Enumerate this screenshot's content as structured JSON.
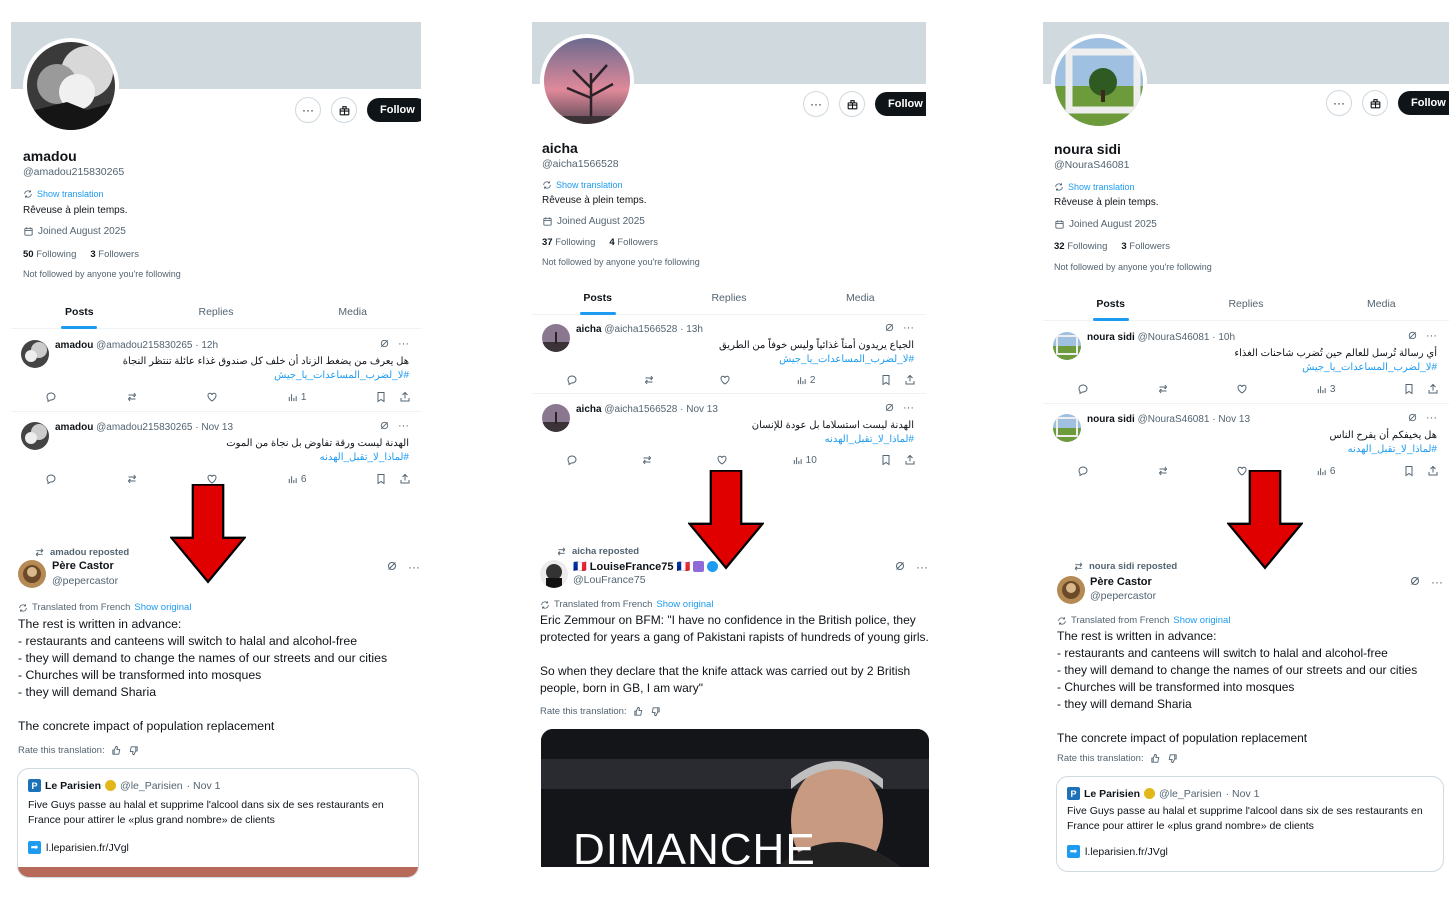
{
  "colors": {
    "accent": "#1d9bf0",
    "arrow": "#e10000",
    "banner": "#cfd9de"
  },
  "profiles": [
    {
      "name": "amadou",
      "handle": "@amadou215830265",
      "show_translation": "Show translation",
      "bio": "Rêveuse à plein temps.",
      "joined": "Joined August 2025",
      "following_count": "50",
      "following_label": "Following",
      "followers_count": "3",
      "followers_label": "Followers",
      "not_followed": "Not followed by anyone you're following",
      "follow": "Follow",
      "more": "···",
      "tabs": [
        "Posts",
        "Replies",
        "Media"
      ],
      "posts": [
        {
          "name": "amadou",
          "meta": "@amadou215830265 · 12h",
          "line1": "هل يعرف من يضغط الزناد أن خلف كل صندوق غذاء عائلة تنتظر النجاة",
          "tag": "#لا_لضرب_المساعدات_يا_جيش",
          "views": "1"
        },
        {
          "name": "amadou",
          "meta": "@amadou215830265 · Nov 13",
          "line1": "الهدنة ليست ورقة تفاوض بل نجاة من الموت",
          "tag": "#لماذا_لا_تقبل_الهدنه",
          "views": "6"
        }
      ]
    },
    {
      "name": "aicha",
      "handle": "@aicha1566528",
      "show_translation": "Show translation",
      "bio": "Rêveuse à plein temps.",
      "joined": "Joined August 2025",
      "following_count": "37",
      "following_label": "Following",
      "followers_count": "4",
      "followers_label": "Followers",
      "not_followed": "Not followed by anyone you're following",
      "follow": "Follow",
      "more": "···",
      "tabs": [
        "Posts",
        "Replies",
        "Media"
      ],
      "posts": [
        {
          "name": "aicha",
          "meta": "@aicha1566528 · 13h",
          "line1": "الجياع يريدون أمناً غذائياً وليس خوفاً من الطريق",
          "tag": "#لا_لضرب_المساعدات_يا_جيش",
          "views": "2"
        },
        {
          "name": "aicha",
          "meta": "@aicha1566528 · Nov 13",
          "line1": "الهدنة ليست استسلاما بل عودة للإنسان",
          "tag": "#لماذا_لا_تقبل_الهدنه",
          "views": "10"
        }
      ]
    },
    {
      "name": "noura sidi",
      "handle": "@NouraS46081",
      "show_translation": "Show translation",
      "bio": "Rêveuse à plein temps.",
      "joined": "Joined August 2025",
      "following_count": "32",
      "following_label": "Following",
      "followers_count": "3",
      "followers_label": "Followers",
      "not_followed": "Not followed by anyone you're following",
      "follow": "Follow",
      "more": "···",
      "tabs": [
        "Posts",
        "Replies",
        "Media"
      ],
      "posts": [
        {
          "name": "noura sidi",
          "meta": "@NouraS46081 · 10h",
          "line1": "أي رسالة تُرسل للعالم حين تُضرب شاحنات الغذاء",
          "tag": "#لا_لضرب_المساعدات_يا_جيش",
          "views": "3"
        },
        {
          "name": "noura sidi",
          "meta": "@NouraS46081 · Nov 13",
          "line1": "هل يخيفكم أن يفرح الناس",
          "tag": "#لماذا_لا_تقبل_الهدنه",
          "views": "6"
        }
      ]
    }
  ],
  "reposts": [
    {
      "reposted_by": "amadou reposted",
      "name": "Père Castor",
      "handle": "@pepercastor",
      "translated": "Translated from French",
      "show_original": "Show original",
      "body": [
        "The rest is written in advance:",
        "- restaurants and canteens will switch to halal and alcohol-free",
        "- they will demand to change the names of our streets and our cities",
        "- Churches will be transformed into mosques",
        "- they will demand Sharia",
        "",
        "The concrete impact of population replacement"
      ],
      "rate": "Rate this translation:",
      "quote": {
        "name": "Le Parisien",
        "handle": "@le_Parisien",
        "date": "· Nov 1",
        "text": "Five Guys passe au halal et supprime l'alcool dans six de ses restaurants en France pour attirer le «plus grand nombre» de clients",
        "link": "l.leparisien.fr/JVgl"
      }
    },
    {
      "reposted_by": "aicha reposted",
      "name": "🇫🇷 LouiseFrance75 🇫🇷",
      "handle": "@LouFrance75",
      "translated": "Translated from French",
      "show_original": "Show original",
      "body": [
        "Eric Zemmour on BFM: \"I have no confidence in the British police, they",
        "protected for years a gang of Pakistani rapists of hundreds of young girls.",
        "",
        "So when they declare that the knife attack was carried out by 2 British",
        "people, born in GB, I am wary\""
      ],
      "rate": "Rate this translation:",
      "media_text": "DIMANCHE"
    },
    {
      "reposted_by": "noura sidi reposted",
      "name": "Père Castor",
      "handle": "@pepercastor",
      "translated": "Translated from French",
      "show_original": "Show original",
      "body": [
        "The rest is written in advance:",
        "- restaurants and canteens will switch to halal and alcohol-free",
        "- they will demand to change the names of our streets and our cities",
        "- Churches will be transformed into mosques",
        "- they will demand Sharia",
        "",
        "The concrete impact of population replacement"
      ],
      "rate": "Rate this translation:",
      "quote": {
        "name": "Le Parisien",
        "handle": "@le_Parisien",
        "date": "· Nov 1",
        "text": "Five Guys passe au halal et supprime l'alcool dans six de ses restaurants en France pour attirer le «plus grand nombre» de clients",
        "link": "l.leparisien.fr/JVgl"
      }
    }
  ]
}
